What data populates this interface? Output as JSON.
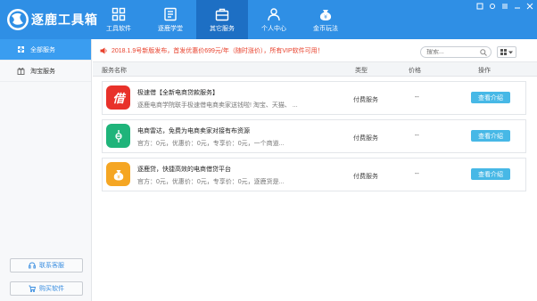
{
  "header": {
    "app_title": "逐鹿工具箱",
    "nav": [
      {
        "label": "工具软件",
        "icon": "apps-grid-icon"
      },
      {
        "label": "逐鹿学堂",
        "icon": "book-icon"
      },
      {
        "label": "其它服务",
        "icon": "briefcase-icon"
      },
      {
        "label": "个人中心",
        "icon": "user-icon"
      },
      {
        "label": "金币玩法",
        "icon": "money-bag-icon"
      }
    ],
    "active_nav": "其它服务"
  },
  "sidebar": {
    "items": [
      {
        "label": "全部服务",
        "icon": "puzzle-icon"
      },
      {
        "label": "淘宝服务",
        "icon": "gift-icon"
      }
    ],
    "contact_label": "联系客服",
    "buy_label": "购买软件"
  },
  "notice": {
    "text": "2018.1.9号新版发布，首发优惠价699元/年（随时涨价），所有VIP软件可用！"
  },
  "search": {
    "placeholder": "搜索..."
  },
  "table": {
    "columns": {
      "name": "服务名称",
      "type": "类型",
      "price": "价格",
      "action": "操作"
    },
    "rows": [
      {
        "icon": "loan-red-icon",
        "title": "极速借【全新电商贷款服务】",
        "desc": "逐鹿电商学院联手极速借电商卖家送钱啦! 淘宝、天猫、 ...",
        "type": "付费服务",
        "price": "--",
        "action": "查看介绍"
      },
      {
        "icon": "radar-green-icon",
        "title": "电商雷达，免费为电商卖家对接有布资源",
        "desc": "官方：0元，优惠价：0元，专享价：0元，一个商道...",
        "type": "付费服务",
        "price": "--",
        "action": "查看介绍"
      },
      {
        "icon": "moneybag-orange-icon",
        "title": "逐鹿贷，快捷高效的电商借贷平台",
        "desc": "官方：0元，优惠价：0元，专享价：0元，逐鹿货是...",
        "type": "付费服务",
        "price": "--",
        "action": "查看介绍"
      }
    ]
  }
}
